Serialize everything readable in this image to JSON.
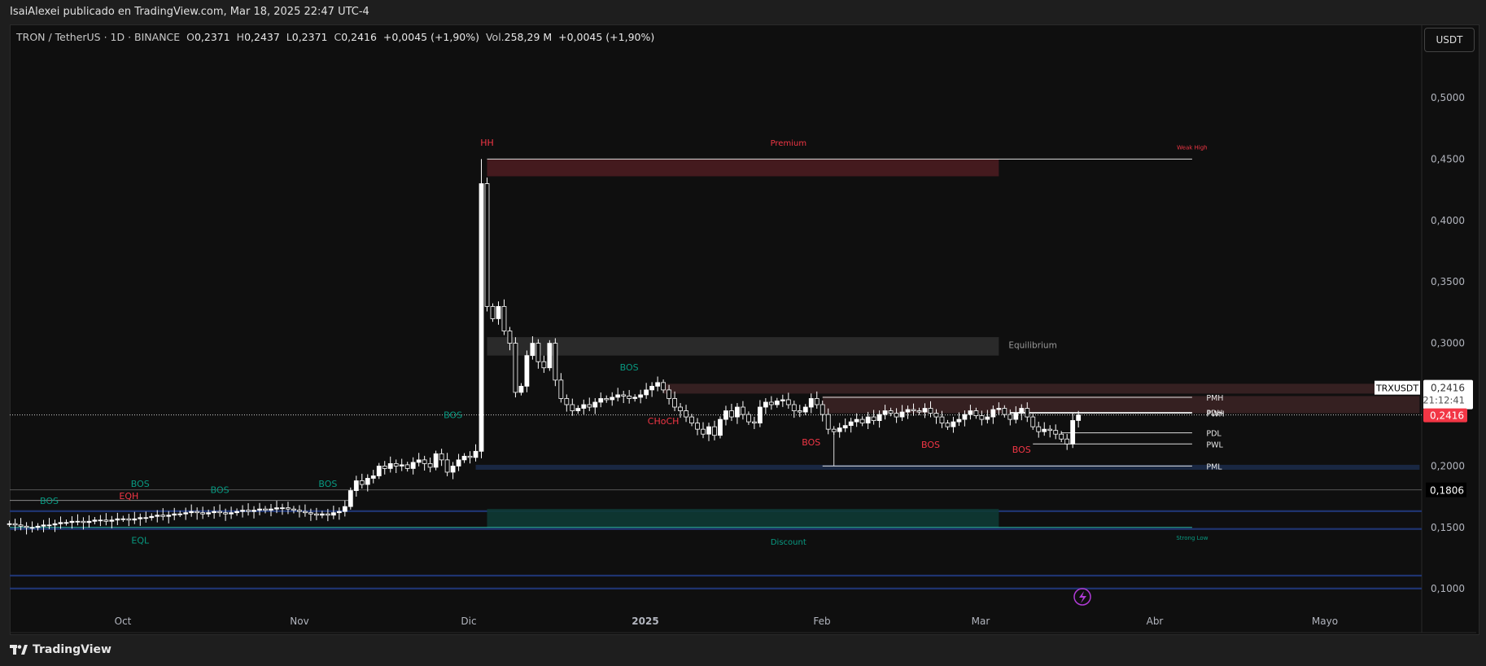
{
  "header": {
    "published": "IsaiAlexei publicado en TradingView.com, Mar 18, 2025 22:47 UTC-4"
  },
  "legend": {
    "symbol": "TRON / TetherUS · 1D · BINANCE",
    "o_label": "O",
    "o": "0,2371",
    "h_label": "H",
    "h": "0,2437",
    "l_label": "L",
    "l": "0,2371",
    "c_label": "C",
    "c": "0,2416",
    "change": "+0,0045 (+1,90%)",
    "vol_label": "Vol.",
    "vol": "258,29 M",
    "vol_change": "+0,0045 (+1,90%)"
  },
  "currency_button": "USDT",
  "price_axis": {
    "ticks": [
      "0,5000",
      "0,4500",
      "0,4000",
      "0,3500",
      "0,3000",
      "0,2000",
      "0,1500",
      "0,1000"
    ],
    "last_price": "0,2416",
    "countdown": "21:12:41",
    "last_price_tag": "0,2416",
    "symbol_tag": "TRXUSDT",
    "line_price": "0,1806"
  },
  "time_axis": {
    "ticks": [
      "Oct",
      "Nov",
      "Dic",
      "2025",
      "Feb",
      "Mar",
      "Abr",
      "Mayo"
    ]
  },
  "colors": {
    "up": "#ffffff",
    "down": "#0f0f0f",
    "premium": "#4a1c20",
    "equilibrium": "#2e2e2e",
    "discount": "#0e3a34",
    "bearish_text": "#f23645",
    "bullish_text": "#089981",
    "blue_zone": "#1b2a48",
    "last_price": "#f23645"
  },
  "watermark": "TradingView",
  "chart_data": {
    "type": "candlestick",
    "symbol": "TRXUSDT",
    "interval": "1D",
    "start_date": "2024-09-11",
    "closes": [
      0.153,
      0.152,
      0.151,
      0.15,
      0.15,
      0.151,
      0.152,
      0.152,
      0.153,
      0.154,
      0.154,
      0.155,
      0.155,
      0.154,
      0.155,
      0.156,
      0.156,
      0.155,
      0.156,
      0.157,
      0.157,
      0.156,
      0.157,
      0.158,
      0.158,
      0.159,
      0.16,
      0.159,
      0.16,
      0.161,
      0.161,
      0.162,
      0.163,
      0.162,
      0.161,
      0.162,
      0.163,
      0.162,
      0.161,
      0.162,
      0.163,
      0.164,
      0.163,
      0.164,
      0.165,
      0.164,
      0.165,
      0.166,
      0.166,
      0.165,
      0.164,
      0.163,
      0.162,
      0.161,
      0.16,
      0.161,
      0.16,
      0.162,
      0.163,
      0.167,
      0.18,
      0.188,
      0.185,
      0.19,
      0.192,
      0.2,
      0.198,
      0.202,
      0.2,
      0.201,
      0.198,
      0.203,
      0.205,
      0.202,
      0.199,
      0.21,
      0.205,
      0.195,
      0.2,
      0.205,
      0.208,
      0.207,
      0.212,
      0.43,
      0.33,
      0.32,
      0.33,
      0.31,
      0.3,
      0.26,
      0.265,
      0.29,
      0.3,
      0.285,
      0.28,
      0.3,
      0.27,
      0.255,
      0.25,
      0.245,
      0.247,
      0.25,
      0.248,
      0.252,
      0.255,
      0.254,
      0.256,
      0.258,
      0.257,
      0.255,
      0.256,
      0.258,
      0.262,
      0.265,
      0.268,
      0.262,
      0.255,
      0.248,
      0.245,
      0.24,
      0.235,
      0.23,
      0.226,
      0.232,
      0.225,
      0.238,
      0.245,
      0.24,
      0.248,
      0.242,
      0.236,
      0.235,
      0.248,
      0.252,
      0.25,
      0.253,
      0.254,
      0.25,
      0.245,
      0.244,
      0.248,
      0.255,
      0.25,
      0.242,
      0.23,
      0.228,
      0.231,
      0.233,
      0.236,
      0.238,
      0.235,
      0.24,
      0.237,
      0.242,
      0.245,
      0.243,
      0.24,
      0.244,
      0.246,
      0.245,
      0.244,
      0.247,
      0.243,
      0.24,
      0.235,
      0.232,
      0.236,
      0.238,
      0.242,
      0.245,
      0.241,
      0.238,
      0.24,
      0.246,
      0.247,
      0.242,
      0.238,
      0.243,
      0.247,
      0.24,
      0.232,
      0.228,
      0.23,
      0.229,
      0.226,
      0.222,
      0.218,
      0.2371,
      0.2416
    ],
    "spike_high": 0.45,
    "y_range": [
      0.09,
      0.52
    ],
    "zones": [
      {
        "name": "premium",
        "from": 0.436,
        "to": 0.45,
        "label": "Premium"
      },
      {
        "name": "equilibrium",
        "from": 0.29,
        "to": 0.305,
        "label": "Equilibrium"
      },
      {
        "name": "discount",
        "from": 0.15,
        "to": 0.165,
        "label": "Discount"
      },
      {
        "name": "supply-1",
        "from": 0.259,
        "to": 0.267
      },
      {
        "name": "supply-2",
        "from": 0.243,
        "to": 0.257
      },
      {
        "name": "demand-1",
        "from": 0.197,
        "to": 0.201
      }
    ],
    "levels": [
      {
        "label": "Weak High",
        "price": 0.45
      },
      {
        "label": "Strong Low",
        "price": 0.15
      },
      {
        "label": "PMH",
        "price": 0.256
      },
      {
        "label": "PDH",
        "price": 0.2437
      },
      {
        "label": "PWH",
        "price": 0.243
      },
      {
        "label": "PDL",
        "price": 0.227
      },
      {
        "label": "PWL",
        "price": 0.218
      },
      {
        "label": "PML",
        "price": 0.2
      }
    ],
    "structure_labels": [
      {
        "text": "HH",
        "type": "bearish"
      },
      {
        "text": "BOS",
        "type": "bullish"
      },
      {
        "text": "BOS",
        "type": "bullish"
      },
      {
        "text": "BOS",
        "type": "bullish"
      },
      {
        "text": "BOS",
        "type": "bullish"
      },
      {
        "text": "BOS",
        "type": "bullish"
      },
      {
        "text": "BOS",
        "type": "bullish"
      },
      {
        "text": "EQH",
        "type": "bearish"
      },
      {
        "text": "EQL",
        "type": "bullish"
      },
      {
        "text": "CHoCH",
        "type": "bearish"
      },
      {
        "text": "BOS",
        "type": "bearish"
      },
      {
        "text": "BOS",
        "type": "bearish"
      },
      {
        "text": "BOS",
        "type": "bearish"
      }
    ]
  }
}
